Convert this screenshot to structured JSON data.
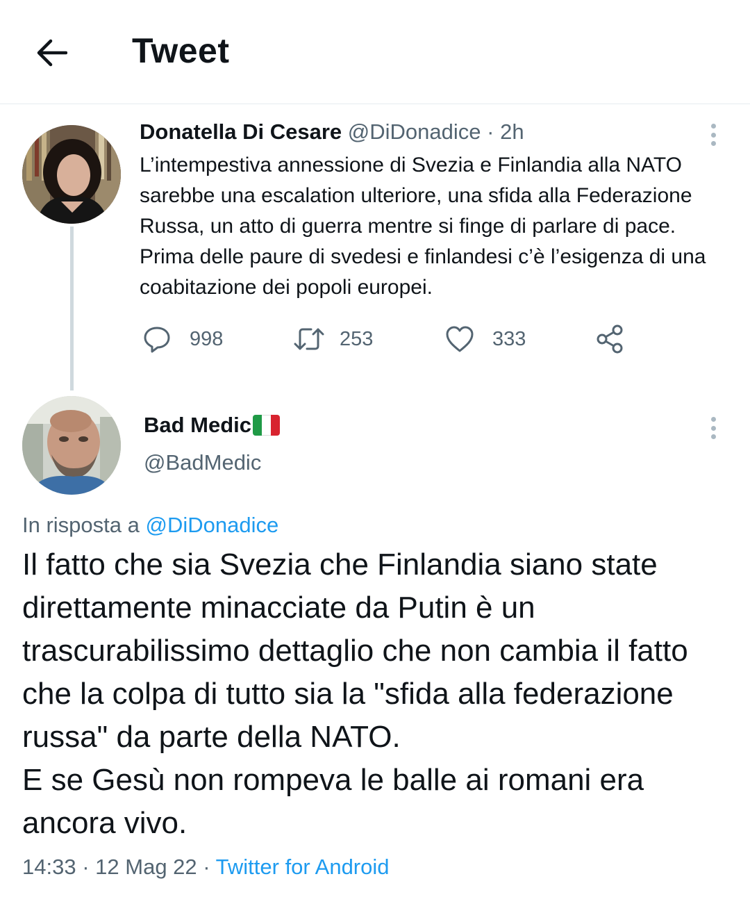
{
  "header": {
    "title": "Tweet",
    "back_icon": "arrow-left-icon"
  },
  "parent_tweet": {
    "author_name": "Donatella Di Cesare",
    "handle": "@DiDonadice",
    "separator": "·",
    "time": "2h",
    "text": "L’intempestiva annessione di Svezia e Finlandia alla NATO sarebbe una escalation ulteriore, una sfida alla Federazione Russa, un atto di guerra mentre si finge di parlare di pace. Prima delle paure di svedesi e finlandesi c’è l’esigenza di una coabitazione dei popoli europei.",
    "actions": {
      "replies": "998",
      "retweets": "253",
      "likes": "333"
    }
  },
  "main_tweet": {
    "author_name": "Bad Medic",
    "flag_colors": [
      "#1f9a46",
      "#ffffff",
      "#d8232f"
    ],
    "handle": "@BadMedic",
    "reply_prefix": "In risposta a",
    "reply_handle": "@DiDonadice",
    "text": "Il fatto che sia Svezia che Finlandia siano state direttamente minacciate da Putin è un trascurabilissimo dettaglio che non cambia il fatto che la colpa di tutto sia la \"sfida alla federazione russa\" da parte della NATO.\nE se Gesù non rompeva le balle ai romani era ancora vivo.",
    "time": "14:33",
    "separator1": "·",
    "date": "12 Mag 22",
    "separator2": "·",
    "source": "Twitter for Android"
  },
  "colors": {
    "text": "#0f1419",
    "muted": "#536471",
    "link": "#1d9bf0",
    "divider": "#e6ecf0"
  }
}
